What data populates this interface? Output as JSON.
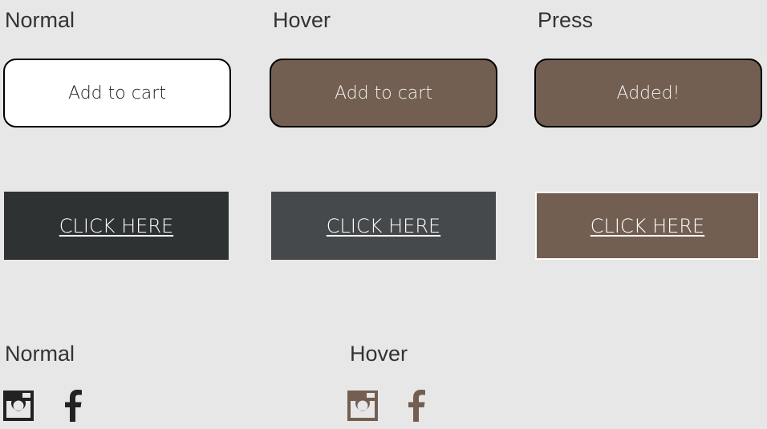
{
  "button_states": {
    "normal_label": "Normal",
    "hover_label": "Hover",
    "press_label": "Press"
  },
  "cart_buttons": {
    "normal": "Add to cart",
    "hover": "Add to cart",
    "press": "Added!"
  },
  "click_buttons": {
    "normal": "CLICK HERE",
    "hover": "CLICK HERE",
    "press": "CLICK HERE"
  },
  "social_states": {
    "normal_label": "Normal",
    "hover_label": "Hover"
  },
  "colors": {
    "background": "#e8e7e7",
    "brown_accent": "#725f52",
    "dark_normal": "#2e3233",
    "dark_hover": "#45494b",
    "icon_normal": "#222222",
    "icon_hover": "#725f52"
  },
  "icons": {
    "instagram": "instagram-icon",
    "facebook": "facebook-icon"
  }
}
